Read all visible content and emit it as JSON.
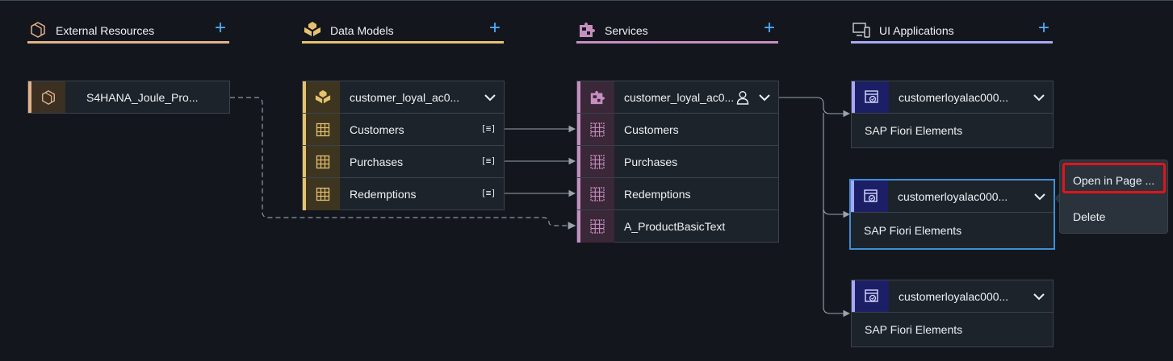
{
  "columns": {
    "external": {
      "title": "External Resources",
      "plus": "+",
      "icon": "external-resource-icon",
      "color": "#e4b28a"
    },
    "models": {
      "title": "Data Models",
      "plus": "+",
      "icon": "data-model-icon",
      "color": "#e6c16e"
    },
    "services": {
      "title": "Services",
      "plus": "+",
      "icon": "service-puzzle-icon",
      "color": "#c68fc0"
    },
    "ui": {
      "title": "UI Applications",
      "plus": "+",
      "icon": "ui-application-icon",
      "color": "#a6a9f2"
    }
  },
  "external_card": {
    "label": "S4HANA_Joule_Pro..."
  },
  "model_card": {
    "title": "customer_loyal_ac0...",
    "entities": [
      {
        "label": "Customers",
        "badge": "[≡]"
      },
      {
        "label": "Purchases",
        "badge": "[≡]"
      },
      {
        "label": "Redemptions",
        "badge": "[≡]"
      }
    ]
  },
  "service_card": {
    "title": "customer_loyal_ac0...",
    "entities": [
      {
        "label": "Customers"
      },
      {
        "label": "Purchases"
      },
      {
        "label": "Redemptions"
      },
      {
        "label": "A_ProductBasicText"
      }
    ]
  },
  "ui_cards": [
    {
      "title": "customerloyalac000...",
      "subtitle": "SAP Fiori Elements"
    },
    {
      "title": "customerloyalac000...",
      "subtitle": "SAP Fiori Elements"
    },
    {
      "title": "customerloyalac000...",
      "subtitle": "SAP Fiori Elements"
    }
  ],
  "context_menu": {
    "items": [
      {
        "label": "Open in Page ..."
      },
      {
        "label": "Delete"
      }
    ]
  }
}
